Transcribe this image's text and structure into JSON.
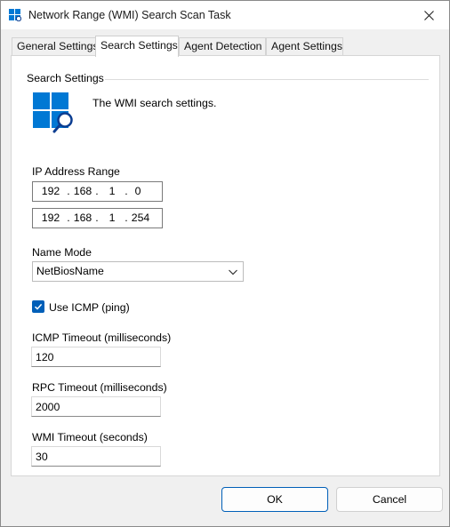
{
  "window": {
    "title": "Network Range (WMI) Search Scan Task",
    "close_glyph": "✕"
  },
  "tabs": [
    {
      "label": "General Settings",
      "active": false
    },
    {
      "label": "Search Settings",
      "active": true
    },
    {
      "label": "Agent Detection",
      "active": false
    },
    {
      "label": "Agent Settings",
      "active": false
    }
  ],
  "search_settings": {
    "group_title": "Search Settings",
    "description": "The WMI search settings.",
    "icon": "windows-search-icon",
    "ip_range": {
      "label": "IP Address Range",
      "start": [
        "192",
        "168",
        "1",
        "0"
      ],
      "end": [
        "192",
        "168",
        "1",
        "254"
      ],
      "separator": "."
    },
    "name_mode": {
      "label": "Name Mode",
      "selected": "NetBiosName"
    },
    "use_icmp": {
      "label": "Use ICMP (ping)",
      "checked": true
    },
    "icmp_timeout": {
      "label": "ICMP Timeout (milliseconds)",
      "value": "120"
    },
    "rpc_timeout": {
      "label": "RPC Timeout (milliseconds)",
      "value": "2000"
    },
    "wmi_timeout": {
      "label": "WMI Timeout (seconds)",
      "value": "30"
    }
  },
  "buttons": {
    "ok": "OK",
    "cancel": "Cancel"
  },
  "colors": {
    "accent": "#005fb8",
    "icon_blue": "#0078d4"
  }
}
